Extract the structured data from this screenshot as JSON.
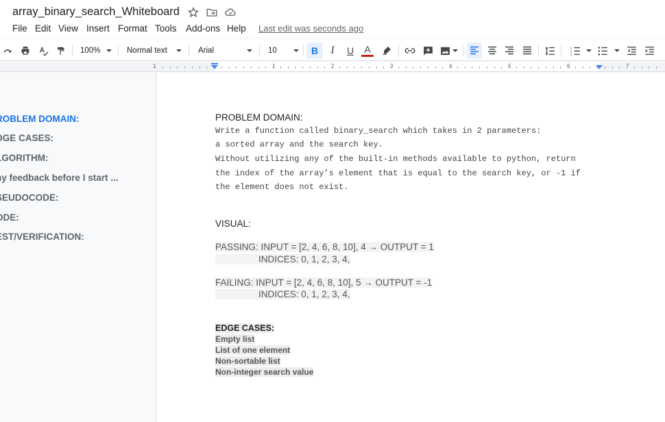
{
  "document": {
    "title": "array_binary_search_Whiteboard"
  },
  "menu": {
    "items": [
      "File",
      "Edit",
      "View",
      "Insert",
      "Format",
      "Tools",
      "Add-ons",
      "Help"
    ],
    "last_edit": "Last edit was seconds ago"
  },
  "toolbar": {
    "zoom": "100%",
    "style": "Normal text",
    "font": "Arial",
    "font_size": "10",
    "bold_active": true,
    "align_left_active": true,
    "text_color": "#c5221f"
  },
  "ruler": {
    "numbers": [
      "1",
      "1",
      "2",
      "3",
      "4",
      "5",
      "6",
      "7"
    ]
  },
  "outline": {
    "items": [
      "ROBLEM DOMAIN:",
      "DGE CASES:",
      "LGORITHM:",
      "ny feedback before I start ...",
      "SEUDOCODE:",
      "ODE:",
      "EST/VERIFICATION:"
    ],
    "selected_index": 0
  },
  "content": {
    "problem_heading": "PROBLEM DOMAIN:",
    "problem_lines": [
      "Write a function called binary_search which takes in 2 parameters:",
      "a sorted array and the search key.",
      "Without utilizing any of the built-in methods available to python, return",
      "the index of the array’s element that is equal to the search key, or -1 if",
      "the element does not exist."
    ],
    "visual_heading": "VISUAL:",
    "passing_line": "PASSING:  INPUT = [2, 4, 6, 8, 10], 4 → OUTPUT = 1",
    "passing_indices": "INDICES: 0, 1, 2, 3,  4,",
    "failing_line": "FAILING:  INPUT = [2, 4, 6, 8, 10], 5 → OUTPUT = -1",
    "failing_indices": "INDICES: 0, 1, 2, 3,  4,",
    "edge_heading": "EDGE CASES:",
    "edge_items": [
      "Empty list",
      "List of one element",
      "Non-sortable list",
      "Non-integer search value"
    ]
  }
}
